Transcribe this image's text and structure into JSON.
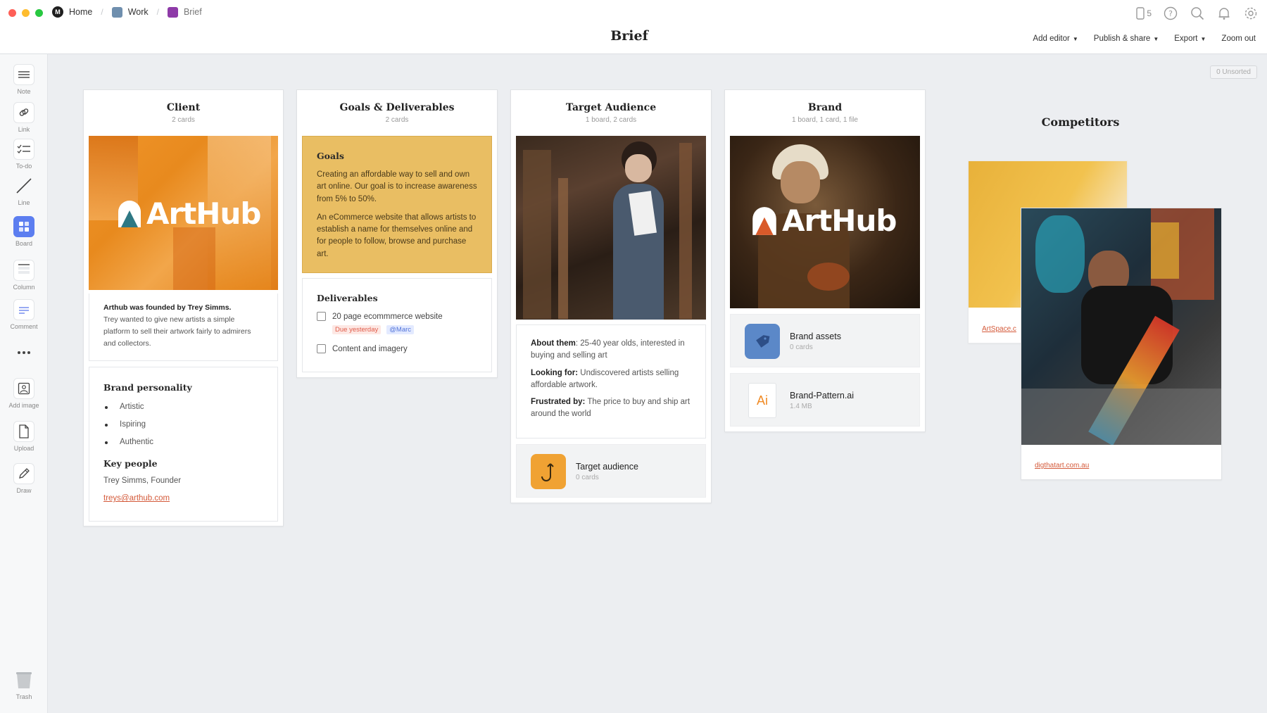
{
  "titlebar": {
    "breadcrumbs": [
      {
        "label": "Home",
        "color": "#1f1f1f"
      },
      {
        "label": "Work",
        "color": "#6f8fae"
      },
      {
        "label": "Brief",
        "color": "#8e3aa8"
      }
    ],
    "title": "Brief",
    "device_count": "5",
    "menu": [
      "Add editor",
      "Publish & share",
      "Export",
      "Zoom out"
    ]
  },
  "toolbar": {
    "tools": [
      {
        "label": "Note",
        "icon": "note-icon"
      },
      {
        "label": "Link",
        "icon": "link-icon"
      },
      {
        "label": "To-do",
        "icon": "todo-icon"
      },
      {
        "label": "Line",
        "icon": "line-icon"
      },
      {
        "label": "Board",
        "icon": "board-icon"
      },
      {
        "label": "Column",
        "icon": "column-icon"
      },
      {
        "label": "Comment",
        "icon": "comment-icon"
      },
      {
        "label": "Add image",
        "icon": "image-icon"
      },
      {
        "label": "Upload",
        "icon": "upload-icon"
      },
      {
        "label": "Draw",
        "icon": "draw-icon"
      },
      {
        "label": "Trash",
        "icon": "trash-icon"
      }
    ]
  },
  "unsorted": "0 Unsorted",
  "columns": {
    "client": {
      "title": "Client",
      "subtitle": "2 cards",
      "logo_text": "ArtHub",
      "founded_bold": "Arthub was founded by Trey Simms.",
      "founded_text": "Trey wanted to give new artists a simple platform to sell their artwork fairly to admirers and collectors.",
      "personality_title": "Brand personality",
      "personality": [
        "Artistic",
        "Ispiring",
        "Authentic"
      ],
      "people_title": "Key people",
      "person": "Trey Simms, Founder",
      "email": "treys@arthub.com"
    },
    "goals": {
      "title": "Goals & Deliverables",
      "subtitle": "2 cards",
      "goals_title": "Goals",
      "goals_p1": "Creating an affordable way to sell and own art online. Our goal is to increase awareness from 5% to 50%.",
      "goals_p2": "An eCommerce website that allows artists to establish a name for themselves online and for people to follow, browse and purchase art.",
      "deliverables_title": "Deliverables",
      "todo1": "20 page ecommmerce website",
      "todo1_due": "Due yesterday",
      "todo1_user": "@Marc",
      "todo2": "Content and imagery"
    },
    "audience": {
      "title": "Target Audience",
      "subtitle": "1 board, 2 cards",
      "about_label": "About them",
      "about_text": ": 25-40 year olds, interested in buying and selling art",
      "looking_label": "Looking for:",
      "looking_text": " Undiscovered artists selling affordable artwork.",
      "frustrated_label": "Frustrated by:",
      "frustrated_text": " The price to buy and ship art around the world",
      "board_name": "Target audience",
      "board_meta": "0 cards"
    },
    "brand": {
      "title": "Brand",
      "subtitle": "1 board, 1 card, 1 file",
      "logo_text": "ArtHub",
      "assets_name": "Brand assets",
      "assets_meta": "0 cards",
      "file_ext": "Ai",
      "file_name": "Brand-Pattern.ai",
      "file_meta": "1.4 MB"
    }
  },
  "competitors": {
    "title": "Competitors",
    "link1": "ArtSpace.c",
    "link2": "digthatart.com.au"
  }
}
